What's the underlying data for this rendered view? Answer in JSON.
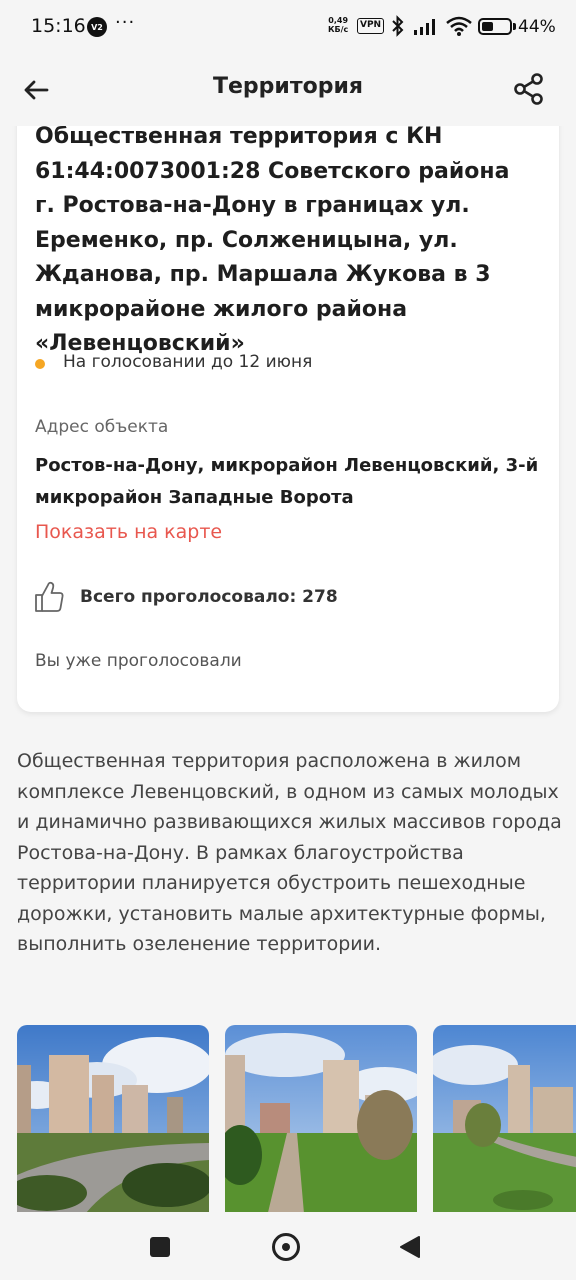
{
  "status_bar": {
    "time": "15:16",
    "badge": "V2",
    "more": "···",
    "speed_value": "0,49",
    "speed_unit": "КБ/с",
    "vpn": "VPN",
    "battery": "44%",
    "battery_level": 0.44
  },
  "app_bar": {
    "title": "Территория"
  },
  "card": {
    "title": "Общественная территория с КН 61:44:0073001:28 Советского района г. Ростова-на-Дону в границах ул. Еременко, пр. Солженицына, ул. Жданова,  пр. Маршала Жукова в 3 микрорайоне жилого района «Левенцовский»",
    "status": "На голосовании до 12 июня",
    "status_color": "#f5a623",
    "address_label": "Адрес объекта",
    "address_value": "Ростов-на-Дону, микрорайон Левенцовский, 3-й микрорайон Западные Ворота",
    "map_link": "Показать на карте",
    "votes": "Всего проголосовало: 278",
    "voted_note": "Вы уже проголосовали"
  },
  "description": "Общественная территория расположена в жилом комплексе Левенцовский, в одном из самых молодых и динамично развивающихся жилых массивов города Ростова-на-Дону.  В рамках благоустройства территории планируется обустроить пешеходные дорожки, установить малые архитектурные формы, выполнить озеленение территории.",
  "colors": {
    "accent_link": "#e8574e",
    "background": "#f5f5f5"
  },
  "icons": {
    "back": "arrow-left-icon",
    "share": "share-icon",
    "like": "thumbs-up-icon",
    "nav_recents": "square-icon",
    "nav_home": "circle-icon",
    "nav_back": "triangle-icon"
  }
}
